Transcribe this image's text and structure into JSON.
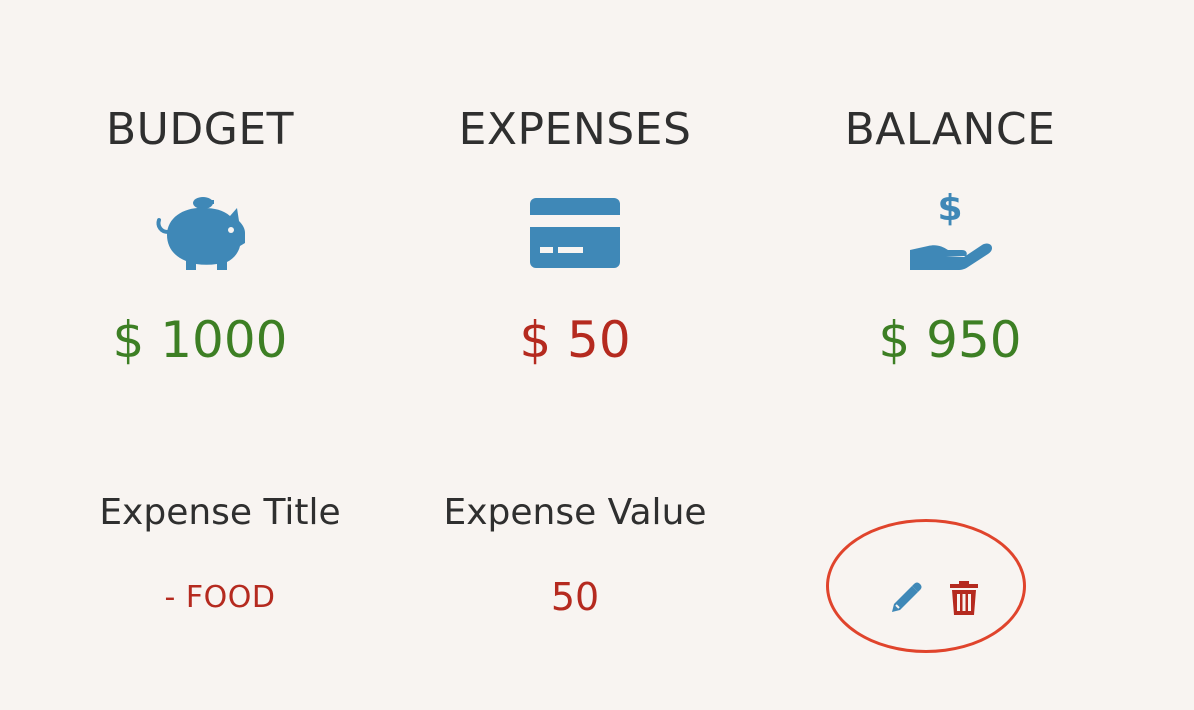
{
  "summary": {
    "budget": {
      "title": "BUDGET",
      "icon": "piggy-bank-icon",
      "amount": "$ 1000",
      "color": "#3d7f24"
    },
    "expenses": {
      "title": "EXPENSES",
      "icon": "credit-card-icon",
      "amount": "$ 50",
      "color": "#b52a1f"
    },
    "balance": {
      "title": "BALANCE",
      "icon": "hand-holding-dollar-icon",
      "amount": "$ 950",
      "color": "#3d7f24"
    }
  },
  "table": {
    "headers": {
      "title": "Expense Title",
      "value": "Expense Value"
    },
    "rows": [
      {
        "title": "- FOOD",
        "value": "50",
        "actions": {
          "edit_icon": "pencil-icon",
          "delete_icon": "trash-icon"
        }
      }
    ]
  },
  "colors": {
    "icon_blue": "#3f88b7",
    "text_dark": "#2f2f2f",
    "green": "#3d7f24",
    "red": "#b52a1f",
    "highlight_circle": "#e0442c",
    "background": "#f8f4f1"
  }
}
